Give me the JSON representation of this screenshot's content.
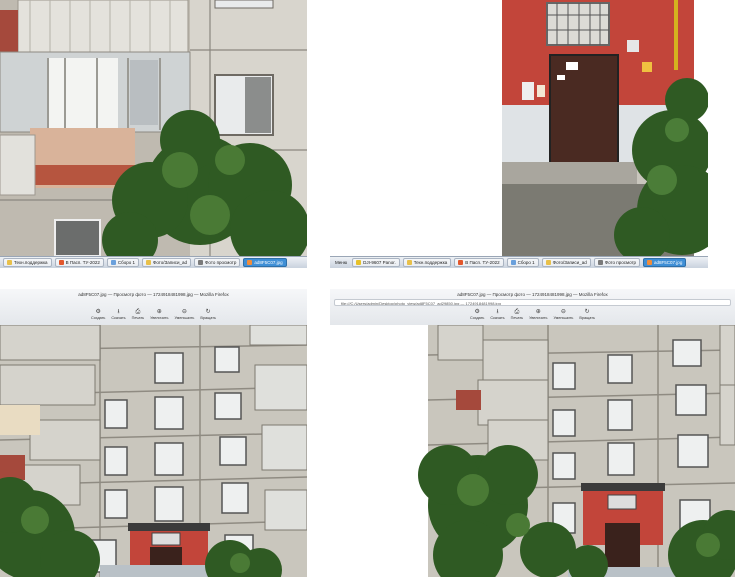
{
  "taskbar_top_left": {
    "items": [
      {
        "label": "Техн.поддержка",
        "icon": "folder-icon",
        "active": false
      },
      {
        "label": "В Пасп. ТУ-2022",
        "icon": "browser-icon",
        "active": false
      },
      {
        "label": "Сборо 1",
        "icon": "document-icon",
        "active": false
      },
      {
        "label": "Фото/Записи_ad",
        "icon": "folder-icon",
        "active": false
      },
      {
        "label": "Фото просмотр",
        "icon": "viewer-icon",
        "active": false
      },
      {
        "label": "ad8F5C07.jpg",
        "icon": "image-icon",
        "active": true
      }
    ]
  },
  "taskbar_top_right": {
    "start_label": "Меню",
    "items": [
      {
        "label": "DJI-9607 Panor.",
        "icon": "star-icon",
        "active": false
      },
      {
        "label": "Техн.поддержка",
        "icon": "folder-icon",
        "active": false
      },
      {
        "label": "В Пасп. ТУ-2022",
        "icon": "browser-icon",
        "active": false
      },
      {
        "label": "Сборо 1",
        "icon": "document-icon",
        "active": false
      },
      {
        "label": "Фото/Записи_ad",
        "icon": "folder-icon",
        "active": false
      },
      {
        "label": "Фото просмотр",
        "icon": "viewer-icon",
        "active": false
      },
      {
        "label": "ad8F5C07.jpg",
        "icon": "image-icon",
        "active": true
      }
    ]
  },
  "viewer_bottom_left": {
    "title": "ad8F5C07.jpg — Просмотр фото — 1724918481998.jpg — Mozilla Firefox",
    "tools": [
      {
        "label": "Создать",
        "icon": "gear-icon"
      },
      {
        "label": "Скачать",
        "icon": "download-icon"
      },
      {
        "label": "Печать",
        "icon": "print-icon"
      },
      {
        "label": "Увеличить",
        "icon": "zoom-in-icon"
      },
      {
        "label": "Уменьшить",
        "icon": "zoom-out-icon"
      },
      {
        "label": "Вращать",
        "icon": "rotate-icon"
      }
    ]
  },
  "viewer_bottom_right": {
    "title": "ad8F5C07.jpg — Просмотр фото — 1724918481998.jpg — Mozilla Firefox",
    "url": "file:///C:/Users/admin/Desktop/photo_view/ad8F5C07_ad29850.jpg — 1724918481998.jpg",
    "tools": [
      {
        "label": "Создать",
        "icon": "gear-icon"
      },
      {
        "label": "Скачать",
        "icon": "download-icon"
      },
      {
        "label": "Печать",
        "icon": "print-icon"
      },
      {
        "label": "Увеличить",
        "icon": "zoom-in-icon"
      },
      {
        "label": "Уменьшить",
        "icon": "zoom-out-icon"
      },
      {
        "label": "Вращать",
        "icon": "rotate-icon"
      }
    ]
  },
  "colors": {
    "taskbar_active": "#3f8fd6",
    "wall_gray": "#c9c6bd",
    "brick_red": "#c2453a",
    "door_brown": "#4a2a22",
    "foliage_green": "#2f5a23"
  }
}
